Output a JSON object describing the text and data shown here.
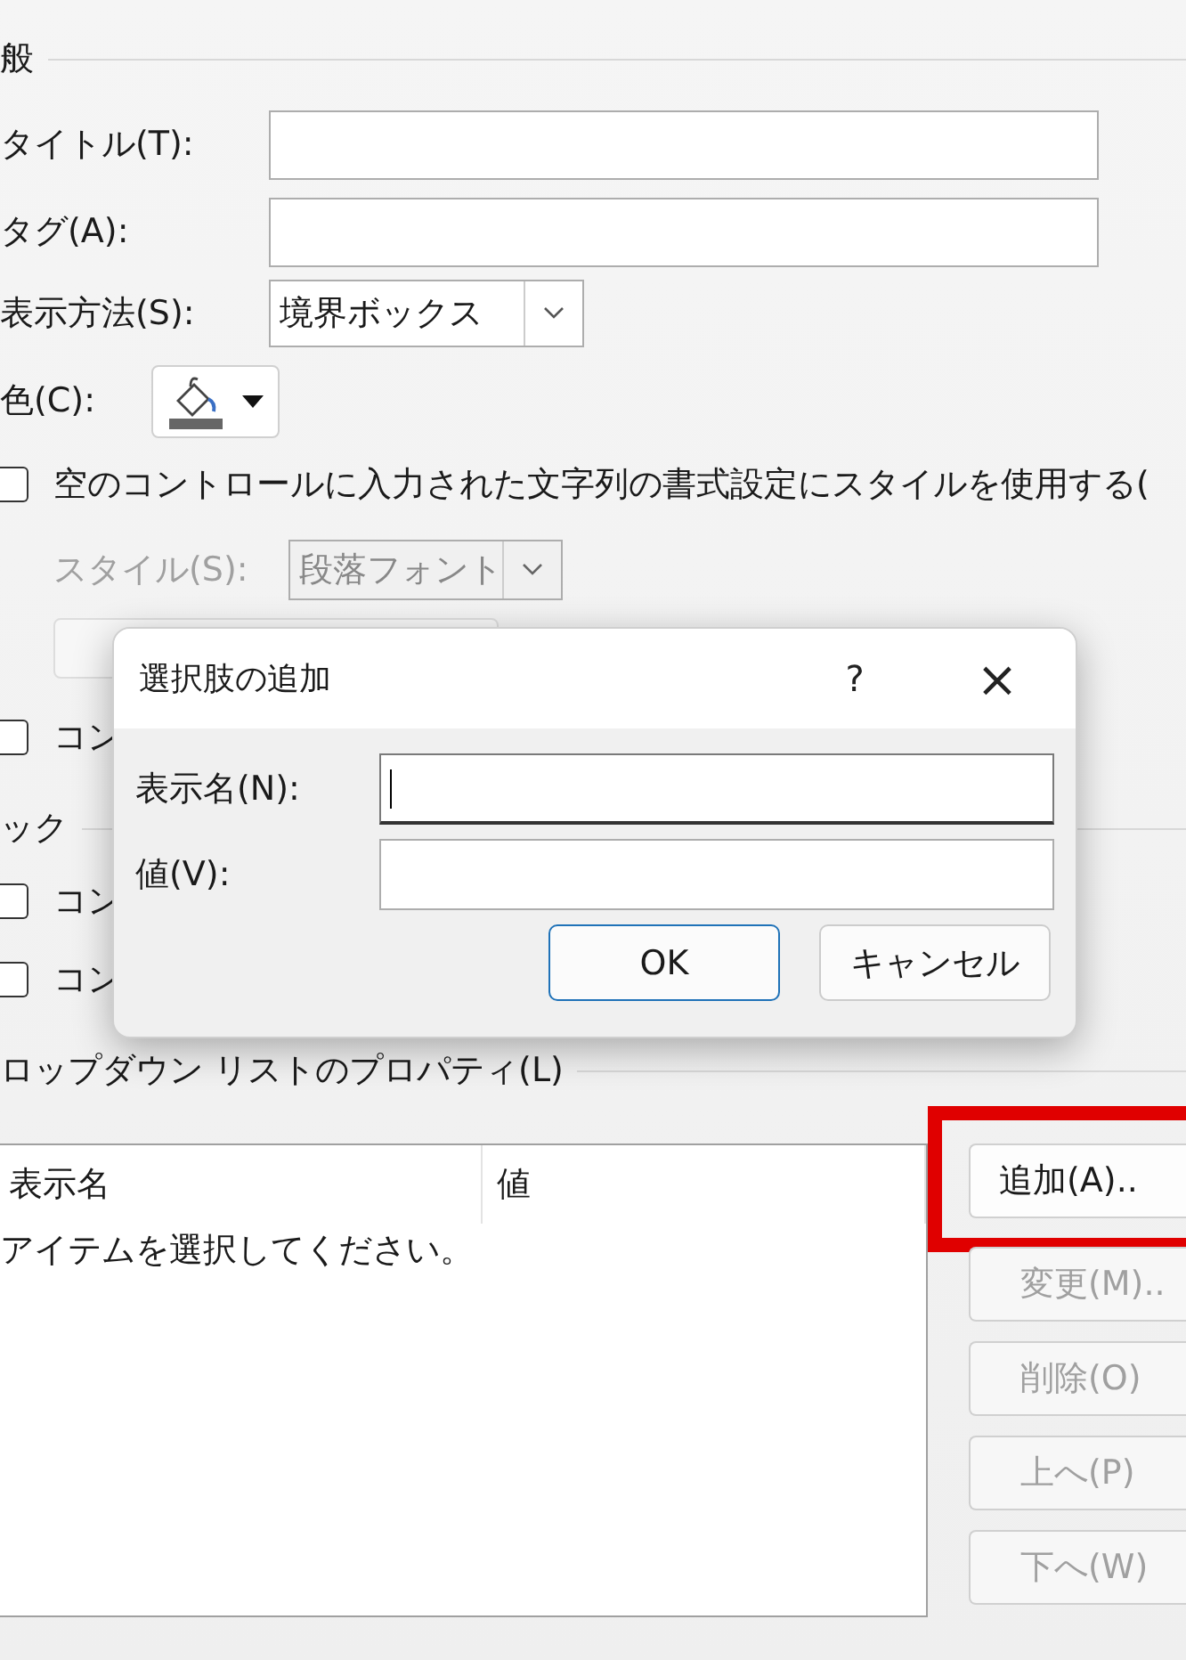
{
  "general": {
    "heading": "般",
    "title_label": "タイトル(T):",
    "tag_label": "タグ(A):",
    "display_label": "表示方法(S):",
    "display_value": "境界ボックス",
    "color_label": "色(C):",
    "use_style": {
      "label": "空のコントロールに入力された文字列の書式設定にスタイルを使用する(",
      "checked": false
    },
    "style_label": "スタイル(S):",
    "style_value": "段落フォント",
    "style_disabled": true,
    "remove_checkbox": {
      "label": "コン",
      "checked": false
    }
  },
  "lock": {
    "heading": "ック",
    "checkboxes": [
      {
        "label": "コン",
        "checked": false
      },
      {
        "label": "コン",
        "checked": false
      }
    ]
  },
  "dropdown": {
    "heading": "ロップダウン リストのプロパティ(L)",
    "columns": [
      "表示名",
      "値"
    ],
    "empty_text": "アイテムを選択してください。",
    "buttons": [
      {
        "label": "追加(A)..",
        "disabled": false,
        "highlighted": true
      },
      {
        "label": "変更(M)..",
        "disabled": true,
        "highlighted": false
      },
      {
        "label": "削除(O)",
        "disabled": true,
        "highlighted": false
      },
      {
        "label": "上へ(P)",
        "disabled": true,
        "highlighted": false
      },
      {
        "label": "下へ(W)",
        "disabled": true,
        "highlighted": false
      }
    ]
  },
  "dialog": {
    "title": "選択肢の追加",
    "help": "?",
    "close": "×",
    "fields": [
      {
        "label": "表示名(N):",
        "focused": true
      },
      {
        "label": "値(V):",
        "focused": false
      }
    ],
    "buttons": [
      {
        "label": "OK",
        "default": true
      },
      {
        "label": "キャンセル",
        "default": false
      }
    ]
  }
}
